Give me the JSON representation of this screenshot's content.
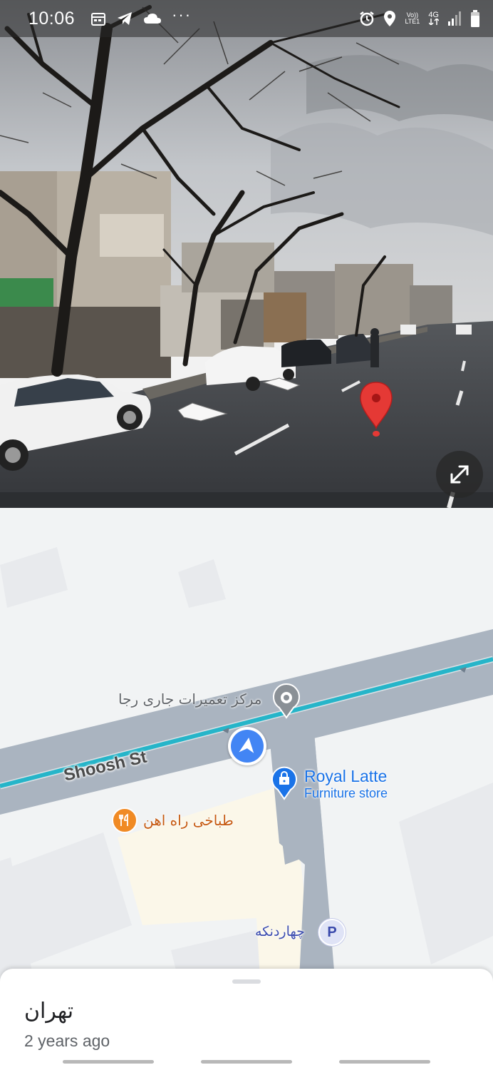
{
  "status_bar": {
    "time": "10:06",
    "dots": "···",
    "network_top": "Vo))",
    "network_bottom": "LTE1",
    "network_type": "4G",
    "icons": [
      "calendar-icon",
      "telegram-icon",
      "cloud-icon",
      "alarm-icon",
      "location-icon",
      "signal-icon",
      "battery-icon"
    ]
  },
  "street_view": {
    "expand_icon": "expand-icon",
    "marker_color": "#e53935"
  },
  "map": {
    "street_name": "Shoosh St",
    "poi_service": "مرکز تعمیرات جاری رجا",
    "poi_store_name": "Royal Latte",
    "poi_store_category": "Furniture store",
    "poi_restaurant": "طباخی راه اهن",
    "poi_parking": "چهاردنکه",
    "parking_letter": "P",
    "route_color": "#26b5c9",
    "road_color": "#aab4c0"
  },
  "bottom_sheet": {
    "title": "تهران",
    "subtitle": "2 years ago"
  }
}
